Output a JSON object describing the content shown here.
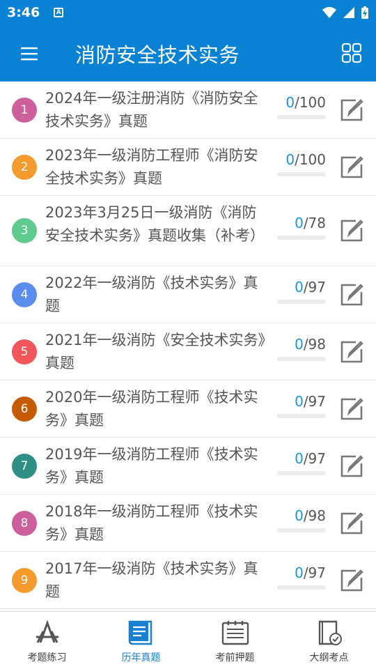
{
  "status": {
    "time": "3:46",
    "notif_glyph": "A"
  },
  "appbar": {
    "title": "消防安全技术实务",
    "menu_icon": "hamburger-menu-icon",
    "grid_icon": "grid-view-icon"
  },
  "items": [
    {
      "index": "1",
      "title": "2024年一级注册消防《消防安全技术实务》真题",
      "done": "0",
      "total": "/100",
      "color": "#cd5f9d",
      "progress": 0
    },
    {
      "index": "2",
      "title": "2023年一级消防工程师《消防安全技术实务》真题",
      "done": "0",
      "total": "/100",
      "color": "#f59b2d",
      "progress": 0
    },
    {
      "index": "3",
      "title": "2023年3月25日一级消防《消防安全技术实务》真题收集（补考）",
      "done": "0",
      "total": "/78",
      "color": "#5fcb8e",
      "progress": 0
    },
    {
      "index": "4",
      "title": "2022年一级消防《技术实务》真题",
      "done": "0",
      "total": "/97",
      "color": "#5b8def",
      "progress": 0
    },
    {
      "index": "5",
      "title": "2021年一级消防《安全技术实务》真题",
      "done": "0",
      "total": "/98",
      "color": "#f0565a",
      "progress": 0
    },
    {
      "index": "6",
      "title": "2020年一级消防工程师《技术实务》真题",
      "done": "0",
      "total": "/97",
      "color": "#c65a00",
      "progress": 0
    },
    {
      "index": "7",
      "title": "2019年一级消防工程师《技术实务》真题",
      "done": "0",
      "total": "/97",
      "color": "#2f8f85",
      "progress": 0
    },
    {
      "index": "8",
      "title": "2018年一级消防工程师《技术实务》真题",
      "done": "0",
      "total": "/98",
      "color": "#cd5f9d",
      "progress": 0
    },
    {
      "index": "9",
      "title": "2017年一级消防《技术实务》真题",
      "done": "0",
      "total": "/97",
      "color": "#f59b2d",
      "progress": 0
    }
  ],
  "nav": [
    {
      "label": "考题练习",
      "icon": "practice-icon",
      "active": false
    },
    {
      "label": "历年真题",
      "icon": "past-exams-icon",
      "active": true
    },
    {
      "label": "考前押题",
      "icon": "mock-exam-icon",
      "active": false
    },
    {
      "label": "大纲考点",
      "icon": "syllabus-icon",
      "active": false
    }
  ]
}
